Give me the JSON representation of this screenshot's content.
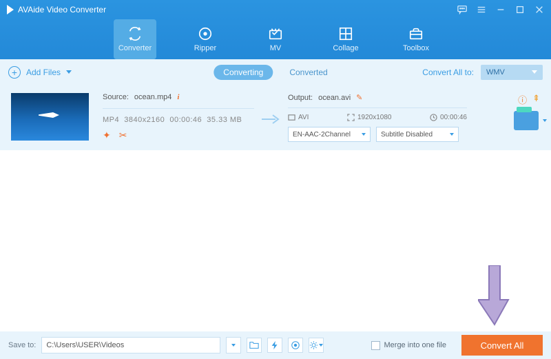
{
  "app": {
    "title": "AVAide Video Converter"
  },
  "nav": {
    "converter": "Converter",
    "ripper": "Ripper",
    "mv": "MV",
    "collage": "Collage",
    "toolbox": "Toolbox"
  },
  "toolbar": {
    "add_files": "Add Files",
    "tab_converting": "Converting",
    "tab_converted": "Converted",
    "convert_all_to": "Convert All to:",
    "format_selected": "WMV"
  },
  "file": {
    "source_label": "Source:",
    "source_name": "ocean.mp4",
    "meta_format": "MP4",
    "meta_dims": "3840x2160",
    "meta_duration": "00:00:46",
    "meta_size": "35.33 MB",
    "output_label": "Output:",
    "output_name": "ocean.avi",
    "out_format": "AVI",
    "out_dims": "1920x1080",
    "out_duration": "00:00:46",
    "audio_select": "EN-AAC-2Channel",
    "subtitle_select": "Subtitle Disabled"
  },
  "footer": {
    "save_to_label": "Save to:",
    "path": "C:\\Users\\USER\\Videos",
    "merge_label": "Merge into one file",
    "convert_button": "Convert All"
  }
}
